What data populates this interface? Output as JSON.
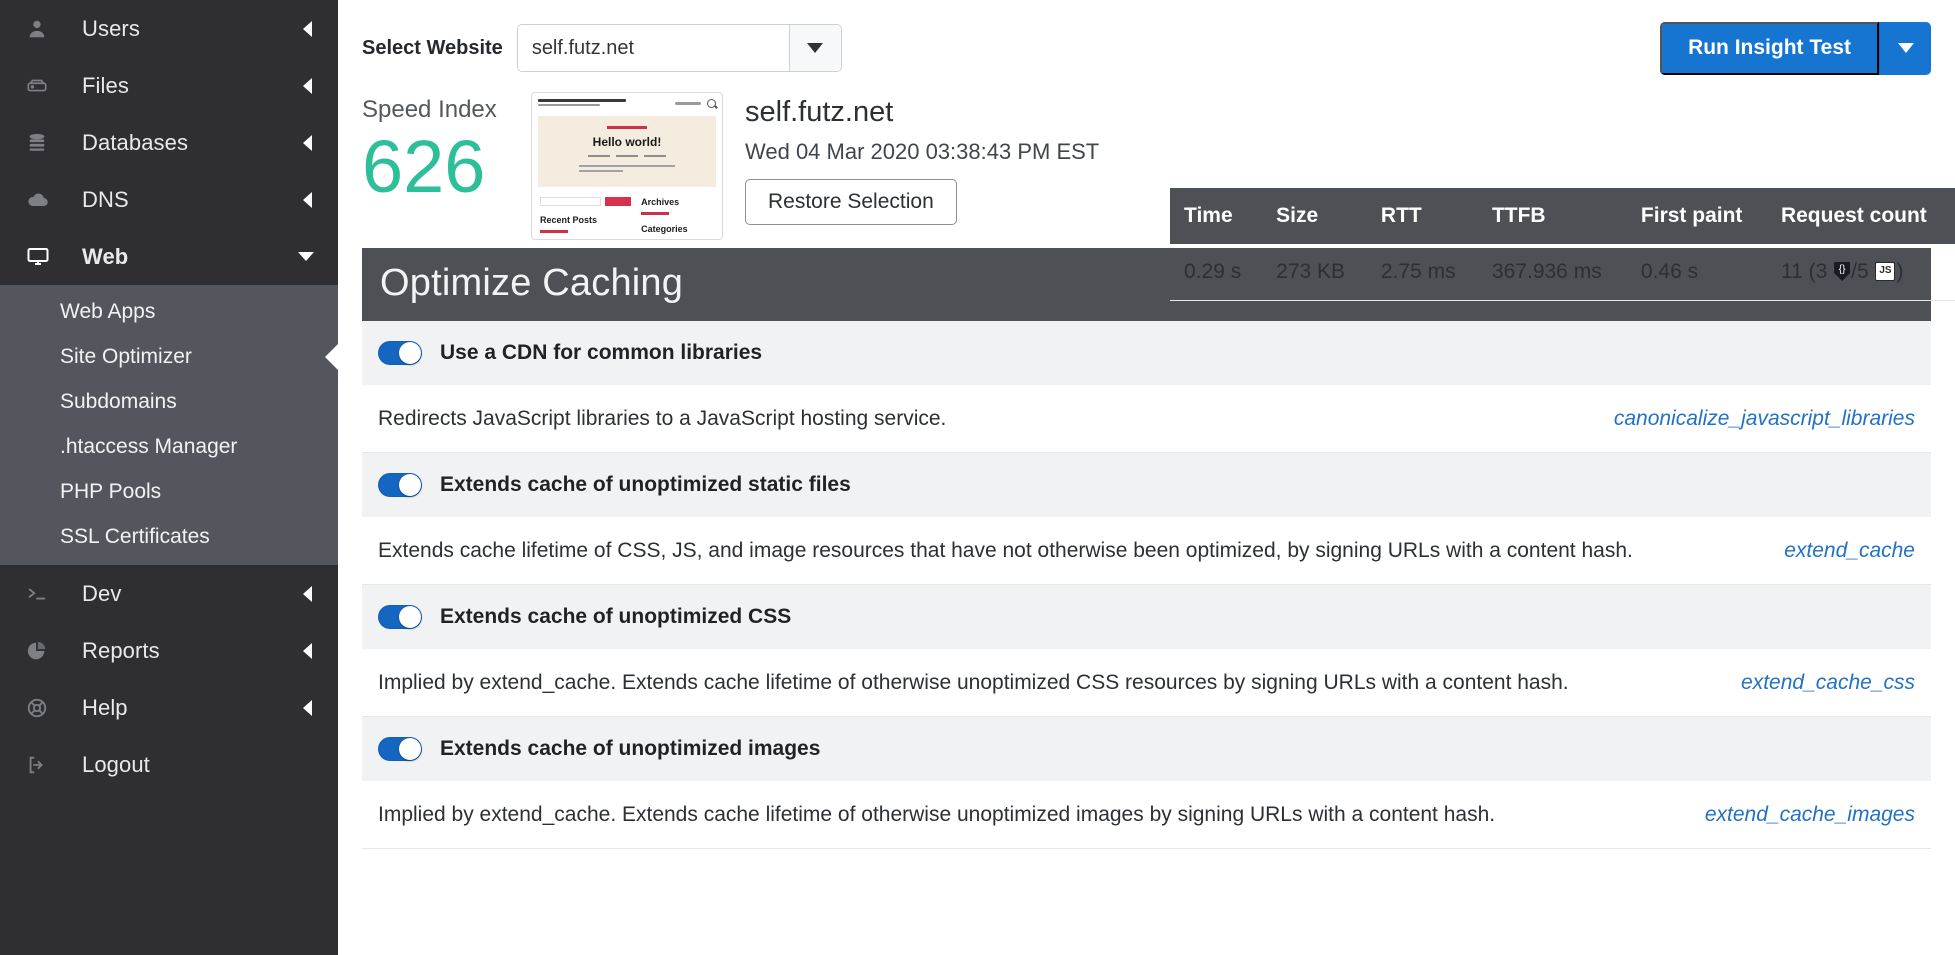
{
  "sidebar": {
    "items": [
      {
        "label": "Users",
        "icon": "user-icon",
        "caret": "left"
      },
      {
        "label": "Files",
        "icon": "drive-icon",
        "caret": "left"
      },
      {
        "label": "Databases",
        "icon": "database-icon",
        "caret": "left"
      },
      {
        "label": "DNS",
        "icon": "cloud-icon",
        "caret": "left"
      },
      {
        "label": "Web",
        "icon": "monitor-icon",
        "caret": "down",
        "active": true
      }
    ],
    "sub_items": [
      {
        "label": "Web Apps"
      },
      {
        "label": "Site Optimizer",
        "selected": true
      },
      {
        "label": "Subdomains"
      },
      {
        "label": ".htaccess Manager"
      },
      {
        "label": "PHP Pools"
      },
      {
        "label": "SSL Certificates"
      }
    ],
    "items_bottom": [
      {
        "label": "Dev",
        "icon": "terminal-icon",
        "caret": "left"
      },
      {
        "label": "Reports",
        "icon": "pie-chart-icon",
        "caret": "left"
      },
      {
        "label": "Help",
        "icon": "lifebuoy-icon",
        "caret": "left"
      },
      {
        "label": "Logout",
        "icon": "logout-icon",
        "caret": "none"
      }
    ]
  },
  "topbar": {
    "select_label": "Select Website",
    "selected_website": "self.futz.net",
    "dropdown_icon": "chevron-down-icon",
    "run_button": "Run Insight Test",
    "run_caret_icon": "chevron-down-icon",
    "accent_color": "#1675d1"
  },
  "summary": {
    "speed_index_label": "Speed Index",
    "speed_index_value": "626",
    "speed_index_color": "#2dbe9a",
    "site_name": "self.futz.net",
    "timestamp": "Wed 04 Mar 2020 03:38:43 PM EST",
    "restore_button": "Restore Selection",
    "thumbnail": {
      "alt": "site-preview-thumbnail",
      "heading": "Hello world!",
      "recent_posts_label": "Recent Posts",
      "archives_label": "Archives",
      "categories_label": "Categories"
    }
  },
  "metrics": {
    "headers": [
      "Time",
      "Size",
      "RTT",
      "TTFB",
      "First paint",
      "Request count"
    ],
    "row": {
      "time": "0.29 s",
      "size": "273 KB",
      "rtt": "2.75 ms",
      "ttfb": "367.936 ms",
      "first_paint": "0.46 s",
      "request_count_prefix": "11 (3 ",
      "request_count_mid": "/5 ",
      "request_count_suffix": ")",
      "css_icon": "css-shield-icon",
      "js_icon": "js-badge-icon"
    }
  },
  "section": {
    "title": "Optimize Caching",
    "options": [
      {
        "label": "Use a CDN for common libraries",
        "enabled": true,
        "description": "Redirects JavaScript libraries to a JavaScript hosting service.",
        "link": "canonicalize_javascript_libraries"
      },
      {
        "label": "Extends cache of unoptimized static files",
        "enabled": true,
        "description": "Extends cache lifetime of CSS, JS, and image resources that have not otherwise been optimized, by signing URLs with a content hash.",
        "link": "extend_cache"
      },
      {
        "label": "Extends cache of unoptimized CSS",
        "enabled": true,
        "description": "Implied by extend_cache. Extends cache lifetime of otherwise unoptimized CSS resources by signing URLs with a content hash.",
        "link": "extend_cache_css"
      },
      {
        "label": "Extends cache of unoptimized images",
        "enabled": true,
        "description": "Implied by extend_cache. Extends cache lifetime of otherwise unoptimized images by signing URLs with a content hash.",
        "link": "extend_cache_images"
      }
    ]
  }
}
